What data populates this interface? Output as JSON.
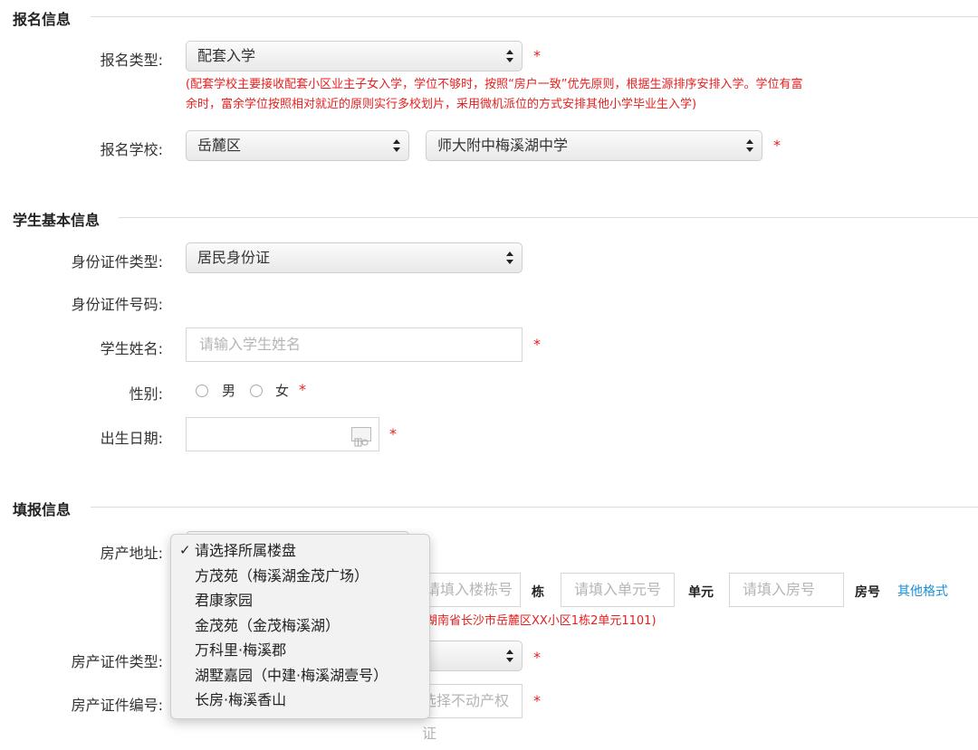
{
  "sections": {
    "registration": "报名信息",
    "student": "学生基本信息",
    "fill": "填报信息"
  },
  "registration": {
    "type_label": "报名类型:",
    "type_value": "配套入学",
    "note_line1": "(配套学校主要接收配套小区业主子女入学，学位不够时，按照“房户一致”优先原则，根据生源排序安排入学。学位有富",
    "note_line2": "余时，富余学位按照相对就近的原则实行多校划片，采用微机派位的方式安排其他小学毕业生入学)",
    "school_label": "报名学校:",
    "district_value": "岳麓区",
    "school_value": "师大附中梅溪湖中学"
  },
  "student": {
    "id_type_label": "身份证件类型:",
    "id_type_value": "居民身份证",
    "id_number_label": "身份证件号码:",
    "name_label": "学生姓名:",
    "name_placeholder": "请输入学生姓名",
    "gender_label": "性别:",
    "gender_male": "男",
    "gender_female": "女",
    "birth_label": "出生日期:"
  },
  "fill": {
    "address_label": "房产地址:",
    "building_placeholder": "请填入楼栋号",
    "building_unit": "栋",
    "unit_placeholder": "请填入单元号",
    "unit_unit": "单元",
    "room_placeholder": "请填入房号",
    "room_unit": "房号",
    "other_format": "其他格式",
    "example_note": "湖南省长沙市岳麓区XX小区1栋2单元1101)",
    "cert_type_label": "房产证件类型:",
    "cert_number_label": "房产证件编号:",
    "cert_number_placeholder": "选择不动产权证"
  },
  "required_mark": "*",
  "dropdown": {
    "checkmark": "✓",
    "options": [
      "请选择所属楼盘",
      "方茂苑（梅溪湖金茂广场）",
      "君康家园",
      "金茂苑（金茂梅溪湖）",
      "万科里·梅溪郡",
      "湖墅嘉园（中建·梅溪湖壹号）",
      "长房·梅溪香山"
    ]
  },
  "colors": {
    "required": "#e52020",
    "link": "#1a8fd6"
  }
}
